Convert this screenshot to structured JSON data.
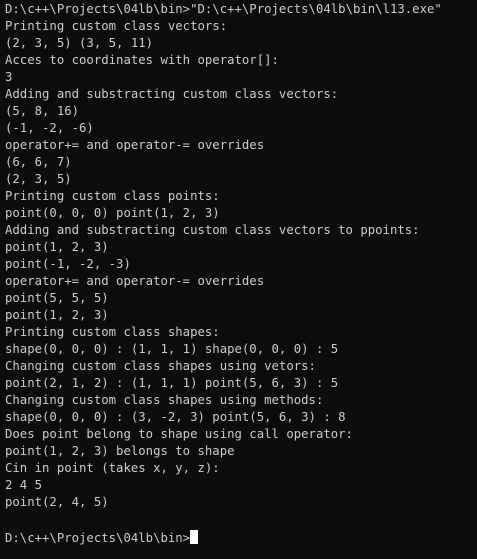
{
  "terminal": {
    "lines": [
      "D:\\c++\\Projects\\04lb\\bin>\"D:\\c++\\Projects\\04lb\\bin\\l13.exe\"",
      "Printing custom class vectors:",
      "(2, 3, 5) (3, 5, 11)",
      "Acces to coordinates with operator[]:",
      "3",
      "Adding and substracting custom class vectors:",
      "(5, 8, 16)",
      "(-1, -2, -6)",
      "operator+= and operator-= overrides",
      "(6, 6, 7)",
      "(2, 3, 5)",
      "Printing custom class points:",
      "point(0, 0, 0) point(1, 2, 3)",
      "Adding and substracting custom class vectors to ppoints:",
      "point(1, 2, 3)",
      "point(-1, -2, -3)",
      "operator+= and operator-= overrides",
      "point(5, 5, 5)",
      "point(1, 2, 3)",
      "Printing custom class shapes:",
      "shape(0, 0, 0) : (1, 1, 1) shape(0, 0, 0) : 5",
      "Changing custom class shapes using vetors:",
      "point(2, 1, 2) : (1, 1, 1) point(5, 6, 3) : 5",
      "Changing custom class shapes using methods:",
      "shape(0, 0, 0) : (3, -2, 3) point(5, 6, 3) : 8",
      "Does point belong to shape using call operator:",
      "point(1, 2, 3) belongs to shape",
      "Cin in point (takes x, y, z):",
      "2 4 5",
      "point(2, 4, 5)"
    ],
    "prompt": "D:\\c++\\Projects\\04lb\\bin>"
  },
  "colors": {
    "background": "#0c0c0c",
    "text": "#cccccc",
    "cursor": "#ffffff"
  }
}
